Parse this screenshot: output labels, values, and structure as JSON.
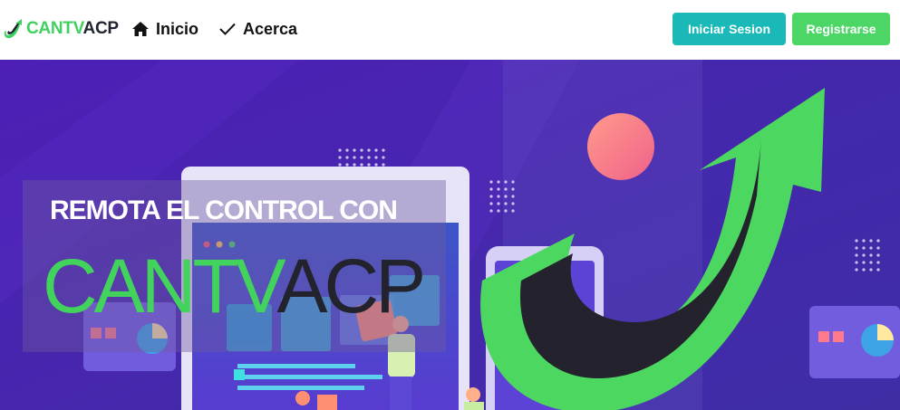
{
  "navbar": {
    "brand": {
      "part1": "CANTV",
      "part2": "ACP",
      "logo_icon": "cantv-swoosh-logo"
    },
    "nav_items": [
      {
        "label": "Inicio",
        "icon": "home-icon"
      },
      {
        "label": "Acerca",
        "icon": "checkmark-icon"
      }
    ],
    "login_label": "Iniciar Sesion",
    "register_label": "Registrarse"
  },
  "hero": {
    "tagline": "REMOTA EL CONTROL CON",
    "brand_part1": "CANTV",
    "brand_part2": "ACP",
    "illustration": "remote-control-illustration"
  },
  "colors": {
    "brand_green": "#42d35c",
    "brand_dark": "#23232e",
    "login_teal": "#1ab9b7",
    "register_green": "#4cd666",
    "hero_purple": "#4a22b0"
  }
}
